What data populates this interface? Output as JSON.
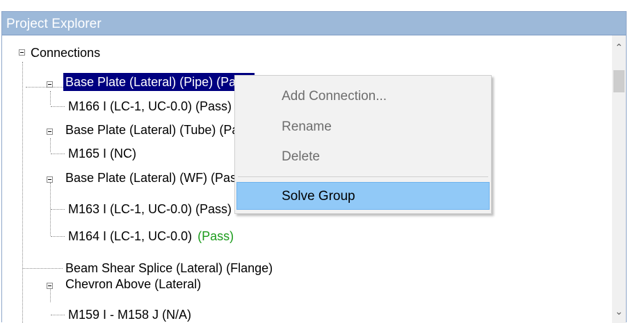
{
  "panel": {
    "title": "Project Explorer"
  },
  "tree": {
    "root": "Connections",
    "items": [
      {
        "label": "Base Plate (Lateral) (Pipe) (Pass)"
      },
      {
        "label": "M166 I (LC-1, UC-0.0) (Pass)"
      },
      {
        "label": "Base Plate (Lateral) (Tube) (Pass)"
      },
      {
        "label": "M165 I (NC)"
      },
      {
        "label": "Base Plate (Lateral) (WF) (Pass)"
      },
      {
        "label": "M163 I (LC-1, UC-0.0) (Pass)"
      },
      {
        "label": "M164 I (LC-1, UC-0.0)",
        "status": "(Pass)"
      },
      {
        "label": "Beam Shear Splice (Lateral) (Flange)"
      },
      {
        "label": "Chevron Above (Lateral)"
      },
      {
        "label": "M159 I - M158 J (N/A)"
      }
    ]
  },
  "context_menu": {
    "items": [
      {
        "label": "Add Connection...",
        "enabled": false
      },
      {
        "label": "Rename",
        "enabled": false
      },
      {
        "label": "Delete",
        "enabled": false
      },
      {
        "label": "Solve Group",
        "enabled": true,
        "highlighted": true
      }
    ]
  },
  "colors": {
    "titlebar": "#9db9d9",
    "selection": "#000080",
    "pass_text": "#1a9b1a",
    "menu_highlight": "#91c9f7"
  }
}
